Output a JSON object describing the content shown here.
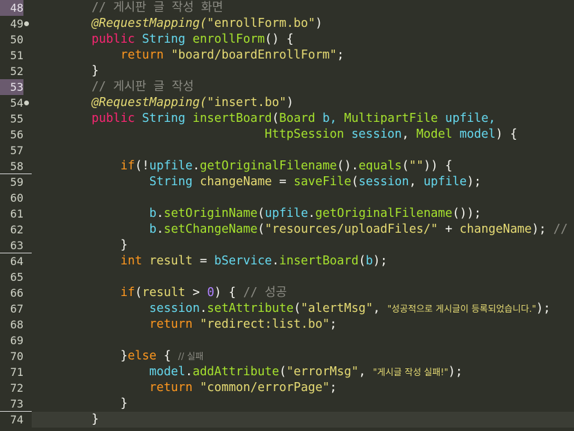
{
  "editor": {
    "lines": [
      {
        "num": "48",
        "tokens": [
          {
            "t": "    // 게시판 글 작성 화면",
            "c": "comment"
          }
        ]
      },
      {
        "num": "49",
        "tokens": [
          {
            "t": "    @RequestMapping(",
            "c": "ann"
          },
          {
            "t": "\"enrollForm.bo\"",
            "c": "str"
          },
          {
            "t": ")",
            "c": "plain"
          }
        ]
      },
      {
        "num": "50",
        "tokens": [
          {
            "t": "    public ",
            "c": "kw"
          },
          {
            "t": "String ",
            "c": "type"
          },
          {
            "t": "enrollForm",
            "c": "method"
          },
          {
            "t": "() {",
            "c": "plain"
          }
        ]
      },
      {
        "num": "51",
        "tokens": [
          {
            "t": "        return ",
            "c": "kw2"
          },
          {
            "t": "\"board/boardEnrollForm\"",
            "c": "str"
          },
          {
            "t": ";",
            "c": "plain"
          }
        ]
      },
      {
        "num": "52",
        "tokens": [
          {
            "t": "    }",
            "c": "plain"
          }
        ]
      },
      {
        "num": "53",
        "tokens": [
          {
            "t": "    // 게시판 글 작성",
            "c": "comment"
          }
        ]
      },
      {
        "num": "54",
        "tokens": [
          {
            "t": "    @RequestMapping(",
            "c": "ann"
          },
          {
            "t": "\"insert.bo\"",
            "c": "str"
          },
          {
            "t": ")",
            "c": "plain"
          }
        ]
      },
      {
        "num": "55",
        "tokens": [
          {
            "t": "    public ",
            "c": "kw"
          },
          {
            "t": "String ",
            "c": "type"
          },
          {
            "t": "insertBoard",
            "c": "method"
          },
          {
            "t": "(",
            "c": "plain"
          },
          {
            "t": "Board ",
            "c": "cls"
          },
          {
            "t": "b, ",
            "c": "var"
          },
          {
            "t": "MultipartFile ",
            "c": "cls"
          },
          {
            "t": "upfile,",
            "c": "var"
          }
        ]
      },
      {
        "num": "56",
        "tokens": [
          {
            "t": "                            HttpSession ",
            "c": "cls"
          },
          {
            "t": "session",
            "c": "var"
          },
          {
            "t": ", ",
            "c": "plain"
          },
          {
            "t": "Model ",
            "c": "cls"
          },
          {
            "t": "model",
            "c": "var"
          },
          {
            "t": ") {",
            "c": "plain"
          }
        ]
      },
      {
        "num": "57",
        "tokens": []
      },
      {
        "num": "58",
        "tokens": [
          {
            "t": "        if",
            "c": "kw2"
          },
          {
            "t": "(!",
            "c": "plain"
          },
          {
            "t": "upfile",
            "c": "var"
          },
          {
            "t": ".",
            "c": "plain"
          },
          {
            "t": "getOriginalFilename",
            "c": "method"
          },
          {
            "t": "().",
            "c": "plain"
          },
          {
            "t": "equals",
            "c": "method"
          },
          {
            "t": "(",
            "c": "plain"
          },
          {
            "t": "\"\"",
            "c": "str"
          },
          {
            "t": ")) {",
            "c": "plain"
          }
        ]
      },
      {
        "num": "59",
        "tokens": [
          {
            "t": "            String ",
            "c": "type"
          },
          {
            "t": "changeName",
            "c": "localvar"
          },
          {
            "t": " = ",
            "c": "plain"
          },
          {
            "t": "saveFile",
            "c": "method"
          },
          {
            "t": "(",
            "c": "plain"
          },
          {
            "t": "session",
            "c": "var"
          },
          {
            "t": ", ",
            "c": "plain"
          },
          {
            "t": "upfile",
            "c": "var"
          },
          {
            "t": ");",
            "c": "plain"
          }
        ]
      },
      {
        "num": "60",
        "tokens": []
      },
      {
        "num": "61",
        "tokens": [
          {
            "t": "            b",
            "c": "var"
          },
          {
            "t": ".",
            "c": "plain"
          },
          {
            "t": "setOriginName",
            "c": "method"
          },
          {
            "t": "(",
            "c": "plain"
          },
          {
            "t": "upfile",
            "c": "var"
          },
          {
            "t": ".",
            "c": "plain"
          },
          {
            "t": "getOriginalFilename",
            "c": "method"
          },
          {
            "t": "());",
            "c": "plain"
          }
        ]
      },
      {
        "num": "62",
        "tokens": [
          {
            "t": "            b",
            "c": "var"
          },
          {
            "t": ".",
            "c": "plain"
          },
          {
            "t": "setChangeName",
            "c": "method"
          },
          {
            "t": "(",
            "c": "plain"
          },
          {
            "t": "\"resources/uploadFiles/\"",
            "c": "str"
          },
          {
            "t": " + ",
            "c": "plain"
          },
          {
            "t": "changeName",
            "c": "localvar"
          },
          {
            "t": "); ",
            "c": "plain"
          },
          {
            "t": "// \"",
            "c": "comment"
          }
        ]
      },
      {
        "num": "63",
        "tokens": [
          {
            "t": "        }",
            "c": "plain"
          }
        ]
      },
      {
        "num": "64",
        "tokens": [
          {
            "t": "        int ",
            "c": "kw2"
          },
          {
            "t": "result",
            "c": "localvar"
          },
          {
            "t": " = ",
            "c": "plain"
          },
          {
            "t": "bService",
            "c": "field"
          },
          {
            "t": ".",
            "c": "plain"
          },
          {
            "t": "insertBoard",
            "c": "method"
          },
          {
            "t": "(",
            "c": "plain"
          },
          {
            "t": "b",
            "c": "var"
          },
          {
            "t": ");",
            "c": "plain"
          }
        ]
      },
      {
        "num": "65",
        "tokens": []
      },
      {
        "num": "66",
        "tokens": [
          {
            "t": "        if",
            "c": "kw2"
          },
          {
            "t": "(",
            "c": "plain"
          },
          {
            "t": "result",
            "c": "localvar"
          },
          {
            "t": " > ",
            "c": "plain"
          },
          {
            "t": "0",
            "c": "num"
          },
          {
            "t": ") { ",
            "c": "plain"
          },
          {
            "t": "// 성공",
            "c": "comment"
          }
        ]
      },
      {
        "num": "67",
        "tokens": [
          {
            "t": "            session",
            "c": "var"
          },
          {
            "t": ".",
            "c": "plain"
          },
          {
            "t": "setAttribute",
            "c": "method"
          },
          {
            "t": "(",
            "c": "plain"
          },
          {
            "t": "\"alertMsg\"",
            "c": "str"
          },
          {
            "t": ", ",
            "c": "plain"
          },
          {
            "t": "\"성공적으로 게시글이 등록되었습니다.\"",
            "c": "str-kr"
          },
          {
            "t": ");",
            "c": "plain"
          }
        ]
      },
      {
        "num": "68",
        "tokens": [
          {
            "t": "            return ",
            "c": "kw2"
          },
          {
            "t": "\"redirect:list.bo\"",
            "c": "str"
          },
          {
            "t": ";",
            "c": "plain"
          }
        ]
      },
      {
        "num": "69",
        "tokens": []
      },
      {
        "num": "70",
        "tokens": [
          {
            "t": "        }",
            "c": "plain"
          },
          {
            "t": "else",
            "c": "kw2"
          },
          {
            "t": " { ",
            "c": "plain"
          },
          {
            "t": "// 실패",
            "c": "comment-kr"
          }
        ]
      },
      {
        "num": "71",
        "tokens": [
          {
            "t": "            model",
            "c": "var"
          },
          {
            "t": ".",
            "c": "plain"
          },
          {
            "t": "addAttribute",
            "c": "method"
          },
          {
            "t": "(",
            "c": "plain"
          },
          {
            "t": "\"errorMsg\"",
            "c": "str"
          },
          {
            "t": ", ",
            "c": "plain"
          },
          {
            "t": "\"게시글 작성 실패!\"",
            "c": "str-kr"
          },
          {
            "t": ");",
            "c": "plain"
          }
        ]
      },
      {
        "num": "72",
        "tokens": [
          {
            "t": "            return ",
            "c": "kw2"
          },
          {
            "t": "\"common/errorPage\"",
            "c": "str"
          },
          {
            "t": ";",
            "c": "plain"
          }
        ]
      },
      {
        "num": "73",
        "tokens": [
          {
            "t": "        }",
            "c": "plain"
          }
        ]
      },
      {
        "num": "74",
        "tokens": [
          {
            "t": "    }",
            "c": "plain"
          }
        ]
      }
    ]
  },
  "colors": {
    "background": "#2f3129",
    "keyword": "#f92672",
    "string": "#e6db74",
    "method": "#a6e22e",
    "type": "#66d9ef",
    "comment": "#8b8b83"
  }
}
